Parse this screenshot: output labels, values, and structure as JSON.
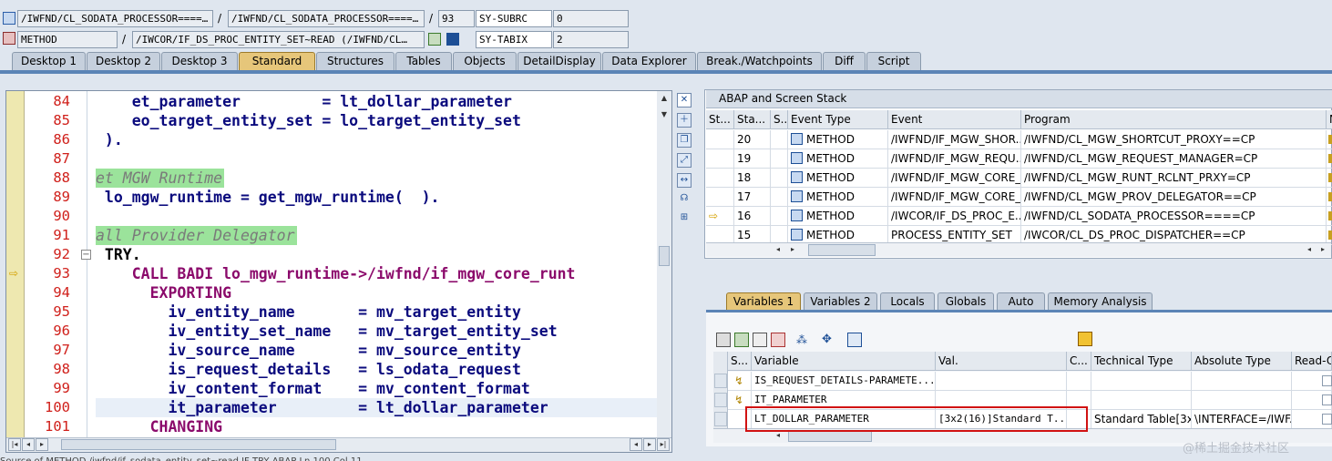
{
  "toolbar": {
    "row1": {
      "field1": "/IWFND/CL_SODATA_PROCESSOR====…",
      "sep1": "/",
      "field2": "/IWFND/CL_SODATA_PROCESSOR====…",
      "sep2": "/",
      "line": "93",
      "sysvar": "SY-SUBRC",
      "sysval": "0"
    },
    "row2": {
      "field1": "METHOD",
      "sep1": "/",
      "field2": "/IWCOR/IF_DS_PROC_ENTITY_SET~READ (/IWFND/CL…",
      "sysvar": "SY-TABIX",
      "sysval": "2"
    }
  },
  "tabs": [
    "Desktop 1",
    "Desktop 2",
    "Desktop 3",
    "Standard",
    "Structures",
    "Tables",
    "Objects",
    "DetailDisplay",
    "Data Explorer",
    "Break./Watchpoints",
    "Diff",
    "Script"
  ],
  "active_tab": "Standard",
  "editor": {
    "lines": [
      {
        "n": "84",
        "code": "    et_parameter         = lt_dollar_parameter",
        "style": "code"
      },
      {
        "n": "85",
        "code": "    eo_target_entity_set = lo_target_entity_set",
        "style": "code"
      },
      {
        "n": "86",
        "code": " ).",
        "style": "code"
      },
      {
        "n": "87",
        "code": "",
        "style": "code"
      },
      {
        "n": "88",
        "code": "et MGW Runtime",
        "style": "cmt"
      },
      {
        "n": "89",
        "code": " lo_mgw_runtime = get_mgw_runtime(  ).",
        "style": "code"
      },
      {
        "n": "90",
        "code": "",
        "style": "code"
      },
      {
        "n": "91",
        "code": "all Provider Delegator",
        "style": "cmt"
      },
      {
        "n": "92",
        "code": " TRY.",
        "style": "try"
      },
      {
        "n": "93",
        "code": "    CALL BADI lo_mgw_runtime->/iwfnd/if_mgw_core_runt",
        "style": "kw"
      },
      {
        "n": "94",
        "code": "      EXPORTING",
        "style": "kw"
      },
      {
        "n": "95",
        "code": "        iv_entity_name       = mv_target_entity",
        "style": "code"
      },
      {
        "n": "96",
        "code": "        iv_entity_set_name   = mv_target_entity_set",
        "style": "code"
      },
      {
        "n": "97",
        "code": "        iv_source_name       = mv_source_entity",
        "style": "code"
      },
      {
        "n": "98",
        "code": "        is_request_details   = ls_odata_request",
        "style": "code"
      },
      {
        "n": "99",
        "code": "        iv_content_format    = mv_content_format",
        "style": "code"
      },
      {
        "n": "100",
        "code": "        it_parameter         = lt_dollar_parameter",
        "style": "code"
      },
      {
        "n": "101",
        "code": "      CHANGING",
        "style": "kw"
      }
    ],
    "current_line": "93"
  },
  "stack": {
    "title": "ABAP and Screen Stack",
    "columns": [
      "St...",
      "Sta...",
      "S...",
      "Event Type",
      "Event",
      "Program",
      "N"
    ],
    "rows": [
      {
        "level": "20",
        "type": "METHOD",
        "event": "/IWFND/IF_MGW_SHOR...",
        "program": "/IWFND/CL_MGW_SHORTCUT_PROXY==CP",
        "current": false
      },
      {
        "level": "19",
        "type": "METHOD",
        "event": "/IWFND/IF_MGW_REQU...",
        "program": "/IWFND/CL_MGW_REQUEST_MANAGER=CP",
        "current": false
      },
      {
        "level": "18",
        "type": "METHOD",
        "event": "/IWFND/IF_MGW_CORE_...",
        "program": "/IWFND/CL_MGW_RUNT_RCLNT_PRXY=CP",
        "current": false
      },
      {
        "level": "17",
        "type": "METHOD",
        "event": "/IWFND/IF_MGW_CORE_...",
        "program": "/IWFND/CL_MGW_PROV_DELEGATOR==CP",
        "current": false
      },
      {
        "level": "16",
        "type": "METHOD",
        "event": "/IWCOR/IF_DS_PROC_E...",
        "program": "/IWFND/CL_SODATA_PROCESSOR====CP",
        "current": true
      },
      {
        "level": "15",
        "type": "METHOD",
        "event": "PROCESS_ENTITY_SET",
        "program": "/IWCOR/CL_DS_PROC_DISPATCHER==CP",
        "current": false
      }
    ]
  },
  "var_tabs": [
    "Variables 1",
    "Variables 2",
    "Locals",
    "Globals",
    "Auto",
    "Memory Analysis"
  ],
  "active_var_tab": "Variables 1",
  "variables": {
    "columns": [
      "S...",
      "Variable",
      "Val.",
      "C...",
      "Technical Type",
      "Absolute Type",
      "Read-O"
    ],
    "rows": [
      {
        "name": "IS_REQUEST_DETAILS-PARAMETE...",
        "value": "",
        "tech": "",
        "abs": ""
      },
      {
        "name": "IT_PARAMETER",
        "value": "",
        "tech": "",
        "abs": ""
      },
      {
        "name": "LT_DOLLAR_PARAMETER",
        "value": "[3x2(16)]Standard T...",
        "tech": "Standard Table[3x...",
        "abs": "\\INTERFACE=/IWF..."
      }
    ]
  },
  "watermark": "@稀土掘金技术社区",
  "status_bar": "Source of METHOD /iwfnd/if_sodata_entity_set~read IF TRY          ABAP     Ln 100 Col 11"
}
